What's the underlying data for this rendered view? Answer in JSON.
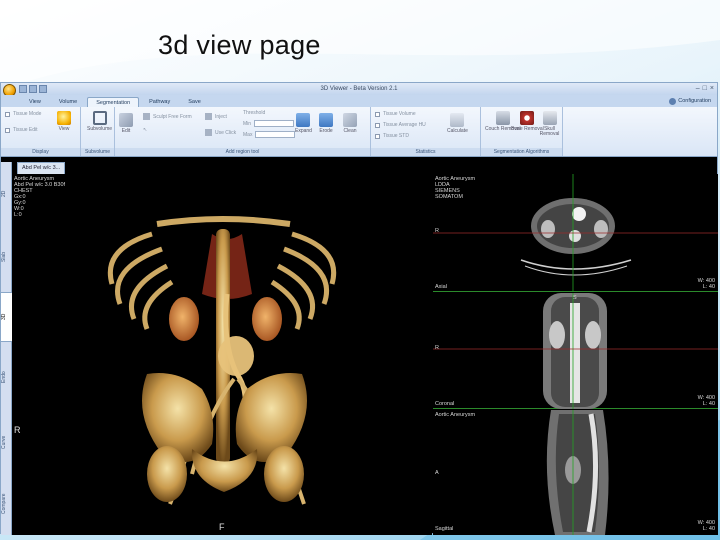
{
  "slide": {
    "title": "3d view page"
  },
  "window": {
    "title": "3D Viewer - Beta Version 2.1"
  },
  "ribbon_tabs": [
    "View",
    "Volume",
    "Segmentation",
    "Pathway",
    "Save"
  ],
  "configuration_label": "Configuration",
  "groups": {
    "display": {
      "label": "Display",
      "tissue_mode": "Tissue Mode",
      "tissue_edit": "Tissue Edit",
      "view_label": "View"
    },
    "subvolume": {
      "label": "Subvolume",
      "button": "Subvolume"
    },
    "add_region": {
      "label": "Add region tool",
      "edit": "Edit",
      "sculpt": "Sculpt Free Form",
      "inject": "Inject",
      "threshold": "Threshold",
      "min": "Min",
      "max": "Max",
      "use_click": "Use Click",
      "expand": "Expand",
      "erode": "Erode",
      "clean": "Clean"
    },
    "statistics": {
      "label": "Statistics",
      "tissue_volume": "Tissue Volume",
      "tissue_average": "Tissue Average HU",
      "tissue_std": "Tissue STD",
      "calculate": "Calculate"
    },
    "segmentation": {
      "label": "Segmentation Algorithms",
      "couch": "Couch Removal",
      "bone": "Bone Removal",
      "skull": "Skull Removal"
    }
  },
  "document_tab": "Abd Pel w/c 3...",
  "side_tabs": [
    "2D",
    "Slab",
    "3D",
    "Endo",
    "Curve",
    "Compare"
  ],
  "viewport_3d": {
    "top_left": [
      "Aortic Aneurysm",
      "Abd Pel w/c 3.0 B30f",
      "CHEST",
      "Gx:0",
      "Gy:0",
      "W:0",
      "L:0"
    ],
    "left_orientation": "R",
    "bottom_orientation": "F"
  },
  "mpr": {
    "axial": {
      "top_left": "Aortic Aneurysm",
      "top_right": [
        "LDDA",
        "SIEMENS",
        "SOMATOM"
      ],
      "left": "R",
      "bottom_left": "Axial",
      "bottom_right": [
        "W: 400",
        "L: 40"
      ]
    },
    "coronal": {
      "top": "S",
      "left": "R",
      "bottom_left": "Coronal",
      "bottom_right": [
        "W: 400",
        "L: 40"
      ]
    },
    "sagittal": {
      "top_left": "Aortic Aneurysm",
      "left": "A",
      "bottom_left": "Sagittal",
      "bottom_right": [
        "W: 400",
        "L: 40"
      ]
    }
  }
}
